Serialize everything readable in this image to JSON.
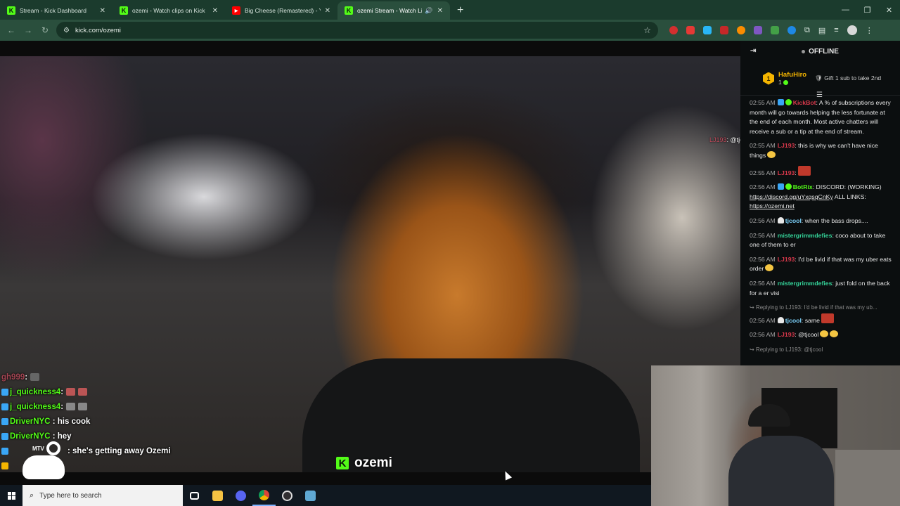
{
  "browser": {
    "tabs": [
      {
        "title": "Stream - Kick Dashboard",
        "favicon": "kick-icon",
        "active": false
      },
      {
        "title": "ozemi - Watch clips on Kick",
        "favicon": "kick-icon",
        "active": false
      },
      {
        "title": "Big Cheese (Remastered) - YouT",
        "favicon": "youtube-icon",
        "active": false
      },
      {
        "title": "ozemi Stream - Watch Live",
        "favicon": "kick-icon",
        "active": true
      }
    ],
    "new_tab": "+",
    "url": "kick.com/ozemi",
    "window_controls": [
      "—",
      "❐",
      "✕"
    ]
  },
  "video": {
    "channel_logo_text": "ozemi",
    "overlay_chat": [
      {
        "user": "gh999",
        "text": "",
        "faded": true
      },
      {
        "user": "j_quickness4",
        "text": ""
      },
      {
        "user": "j_quickness4",
        "text": ""
      },
      {
        "user": "DriverNYC",
        "text": "his cook"
      },
      {
        "user": "DriverNYC",
        "text": "hey"
      },
      {
        "user": "",
        "text": "she's getting away Ozemi"
      },
      {
        "user": "",
        "text": ""
      }
    ],
    "watermark": "MTV",
    "stamp_user": "LJ193",
    "stamp_text": ": @tjcool have"
  },
  "chat": {
    "status": "OFFLINE",
    "pinned": {
      "rank": "1",
      "user": "HafuHiro",
      "count": "1",
      "gift": "Gift 1 sub to take 2nd"
    },
    "messages": [
      {
        "time": "02:55 AM",
        "user": "KickBot",
        "color": "red",
        "badges": [
          "blue",
          "green"
        ],
        "text": ": A % of subscriptions every month will go towards helping the less fortunate at the end of each month. Most active chatters will receive a sub or a tip at the end of stream."
      },
      {
        "time": "02:55 AM",
        "user": "LJ193",
        "color": "red",
        "badges": [],
        "text": ": this is why we can't have nice things",
        "emote": true
      },
      {
        "time": "02:55 AM",
        "user": "LJ193",
        "color": "red",
        "badges": [],
        "text": ":",
        "emote_red": true
      },
      {
        "time": "02:56 AM",
        "user": "BotRix",
        "color": "green",
        "badges": [
          "blue",
          "green"
        ],
        "text": ": DISCORD: (WORKING) ",
        "link1": "https://discord.gg/uYxqsqCnKy",
        "text2": " ALL LINKS: ",
        "link2": "https://ozemi.net"
      },
      {
        "time": "02:56 AM",
        "user": "tjcool",
        "color": "blue",
        "badges": [
          "white"
        ],
        "text": ": when the bass drops...."
      },
      {
        "time": "02:56 AM",
        "user": "mistergrimmdefies",
        "color": "teal",
        "badges": [],
        "text": ": coco about to take one of them to er"
      },
      {
        "time": "02:56 AM",
        "user": "LJ193",
        "color": "red",
        "badges": [],
        "text": ": I'd be livid if that was my uber eats order",
        "emote": true
      },
      {
        "time": "02:56 AM",
        "user": "mistergrimmdefies",
        "color": "teal",
        "badges": [],
        "text": ": just fold on the back for a er visi"
      },
      {
        "reply": "Replying to LJ193: I'd be livid if that was my ub...",
        "time": "02:56 AM",
        "user": "tjcool",
        "color": "blue",
        "badges": [
          "white"
        ],
        "text": ": same",
        "emote_red": true
      },
      {
        "time": "02:56 AM",
        "user": "LJ193",
        "color": "red",
        "badges": [],
        "text": ": @tjcool",
        "emote": true,
        "emote2": true
      },
      {
        "reply": "Replying to LJ193: @tjcool",
        "time": "",
        "user": "",
        "color": "blue",
        "badges": [],
        "text": ""
      }
    ]
  },
  "taskbar": {
    "search_placeholder": "Type here to search",
    "apps": [
      "task-view-icon",
      "file-explorer-icon",
      "discord-icon",
      "chrome-icon",
      "obs-icon",
      "notepad-icon"
    ]
  },
  "colors": {
    "kick_green": "#53fc18",
    "tab_bg": "#1b3b2d",
    "toolbar_bg": "#2a4f3d",
    "chat_bg": "#0b0e0f"
  }
}
